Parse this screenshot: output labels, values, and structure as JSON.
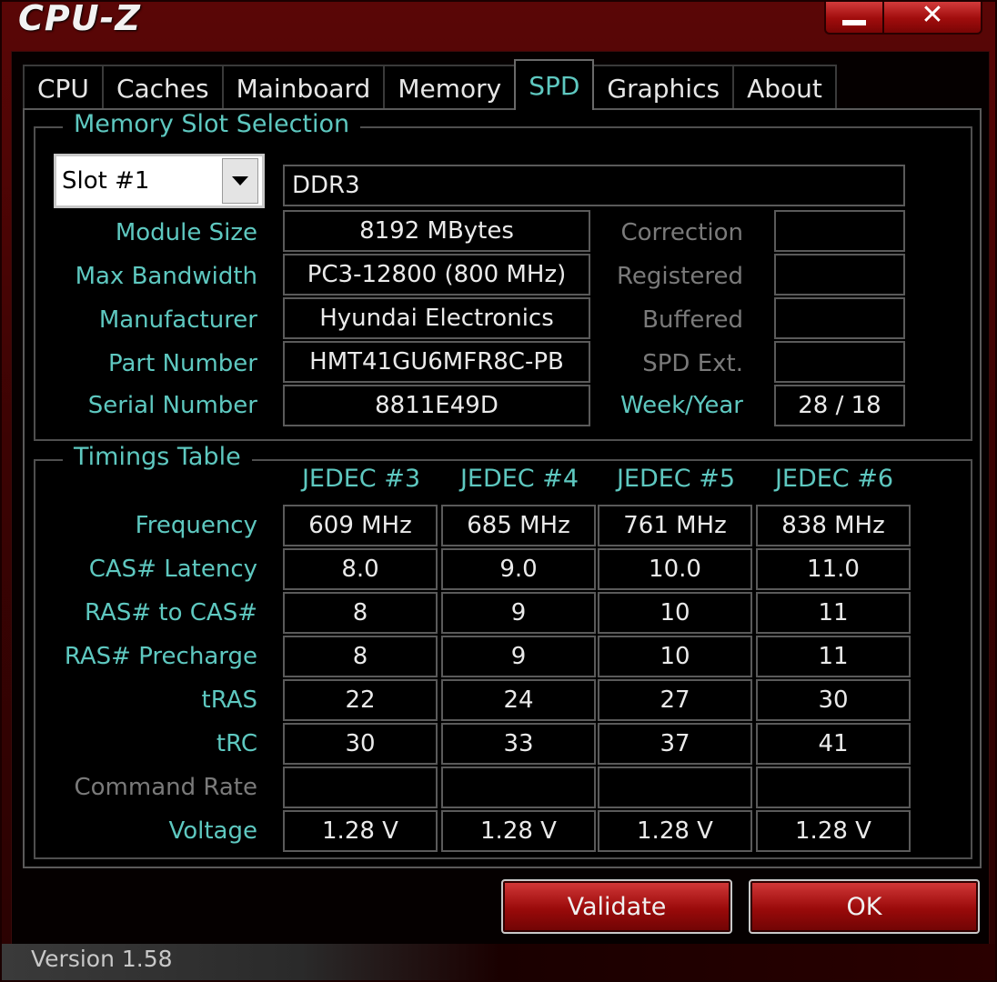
{
  "window": {
    "title": "CPU-Z",
    "minimize_label": "",
    "close_label": "✕"
  },
  "tabs": [
    "CPU",
    "Caches",
    "Mainboard",
    "Memory",
    "SPD",
    "Graphics",
    "About"
  ],
  "active_tab": "SPD",
  "slot_section": {
    "title": "Memory Slot Selection",
    "slot_value": "Slot #1",
    "memory_type": "DDR3",
    "fields": {
      "module_size": {
        "label": "Module Size",
        "value": "8192 MBytes"
      },
      "max_bandwidth": {
        "label": "Max Bandwidth",
        "value": "PC3-12800 (800 MHz)"
      },
      "manufacturer": {
        "label": "Manufacturer",
        "value": "Hyundai Electronics"
      },
      "part_number": {
        "label": "Part Number",
        "value": "HMT41GU6MFR8C-PB"
      },
      "serial_number": {
        "label": "Serial Number",
        "value": "8811E49D"
      }
    },
    "side_fields": {
      "correction": {
        "label": "Correction",
        "value": ""
      },
      "registered": {
        "label": "Registered",
        "value": ""
      },
      "buffered": {
        "label": "Buffered",
        "value": ""
      },
      "spd_ext": {
        "label": "SPD Ext.",
        "value": ""
      },
      "week_year": {
        "label": "Week/Year",
        "value": "28 / 18"
      }
    }
  },
  "timings": {
    "title": "Timings Table",
    "columns": [
      "JEDEC #3",
      "JEDEC #4",
      "JEDEC #5",
      "JEDEC #6"
    ],
    "rows": [
      {
        "label": "Frequency",
        "values": [
          "609 MHz",
          "685 MHz",
          "761 MHz",
          "838 MHz"
        ],
        "dim": false
      },
      {
        "label": "CAS# Latency",
        "values": [
          "8.0",
          "9.0",
          "10.0",
          "11.0"
        ],
        "dim": false
      },
      {
        "label": "RAS# to CAS#",
        "values": [
          "8",
          "9",
          "10",
          "11"
        ],
        "dim": false
      },
      {
        "label": "RAS# Precharge",
        "values": [
          "8",
          "9",
          "10",
          "11"
        ],
        "dim": false
      },
      {
        "label": "tRAS",
        "values": [
          "22",
          "24",
          "27",
          "30"
        ],
        "dim": false
      },
      {
        "label": "tRC",
        "values": [
          "30",
          "33",
          "37",
          "41"
        ],
        "dim": false
      },
      {
        "label": "Command Rate",
        "values": [
          "",
          "",
          "",
          ""
        ],
        "dim": true
      },
      {
        "label": "Voltage",
        "values": [
          "1.28 V",
          "1.28 V",
          "1.28 V",
          "1.28 V"
        ],
        "dim": false
      }
    ]
  },
  "buttons": {
    "validate": "Validate",
    "ok": "OK"
  },
  "status": {
    "version": "Version 1.58"
  },
  "colors": {
    "accent": "#5ec8c0",
    "frame": "#5a0606",
    "dim_label": "#7a7a7a"
  }
}
